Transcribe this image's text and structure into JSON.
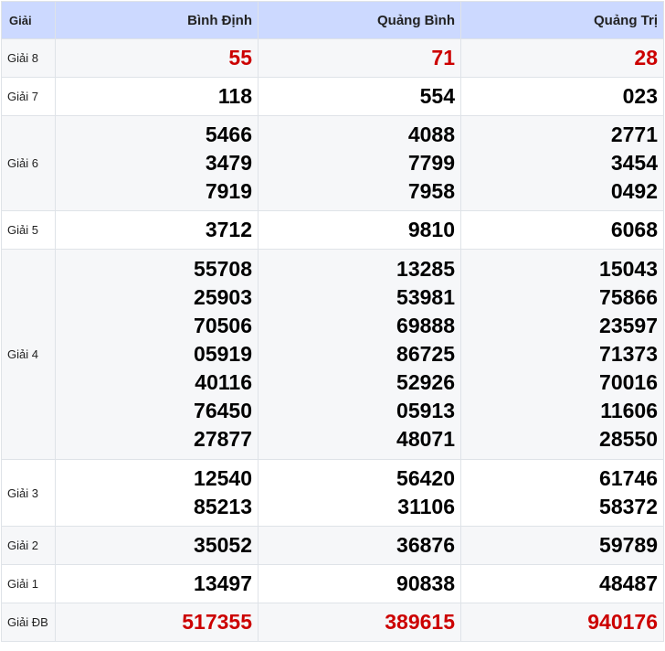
{
  "header": {
    "prize_col": "Giải",
    "provinces": [
      "Bình Định",
      "Quảng Bình",
      "Quảng Trị"
    ]
  },
  "colors": {
    "header_bg": "#ccd9ff",
    "highlight_red": "#cc0000",
    "row_alt_bg": "#f6f7f9"
  },
  "rows": [
    {
      "label": "Giải 8",
      "numbers": [
        [
          "55"
        ],
        [
          "71"
        ],
        [
          "28"
        ]
      ],
      "highlight": true
    },
    {
      "label": "Giải 7",
      "numbers": [
        [
          "118"
        ],
        [
          "554"
        ],
        [
          "023"
        ]
      ],
      "highlight": false
    },
    {
      "label": "Giải 6",
      "numbers": [
        [
          "5466",
          "3479",
          "7919"
        ],
        [
          "4088",
          "7799",
          "7958"
        ],
        [
          "2771",
          "3454",
          "0492"
        ]
      ],
      "highlight": false
    },
    {
      "label": "Giải 5",
      "numbers": [
        [
          "3712"
        ],
        [
          "9810"
        ],
        [
          "6068"
        ]
      ],
      "highlight": false
    },
    {
      "label": "Giải 4",
      "numbers": [
        [
          "55708",
          "25903",
          "70506",
          "05919",
          "40116",
          "76450",
          "27877"
        ],
        [
          "13285",
          "53981",
          "69888",
          "86725",
          "52926",
          "05913",
          "48071"
        ],
        [
          "15043",
          "75866",
          "23597",
          "71373",
          "70016",
          "11606",
          "28550"
        ]
      ],
      "highlight": false
    },
    {
      "label": "Giải 3",
      "numbers": [
        [
          "12540",
          "85213"
        ],
        [
          "56420",
          "31106"
        ],
        [
          "61746",
          "58372"
        ]
      ],
      "highlight": false
    },
    {
      "label": "Giải 2",
      "numbers": [
        [
          "35052"
        ],
        [
          "36876"
        ],
        [
          "59789"
        ]
      ],
      "highlight": false
    },
    {
      "label": "Giải 1",
      "numbers": [
        [
          "13497"
        ],
        [
          "90838"
        ],
        [
          "48487"
        ]
      ],
      "highlight": false
    },
    {
      "label": "Giải ĐB",
      "numbers": [
        [
          "517355"
        ],
        [
          "389615"
        ],
        [
          "940176"
        ]
      ],
      "highlight": true
    }
  ]
}
